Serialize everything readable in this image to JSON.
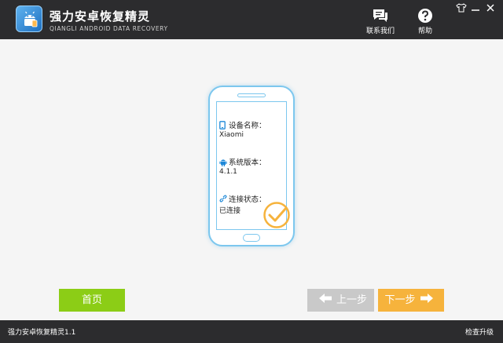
{
  "app": {
    "title": "强力安卓恢复精灵",
    "subtitle": "QIANGLI ANDROID DATA RECOVERY"
  },
  "header": {
    "contact_label": "联系我们",
    "help_label": "帮助"
  },
  "device": {
    "name_label": "设备名称：",
    "name_value": "Xiaomi",
    "version_label": "系统版本：",
    "version_value": "4.1.1",
    "status_label": "连接状态：",
    "status_value": "已连接"
  },
  "nav": {
    "home_label": "首页",
    "prev_label": "上一步",
    "next_label": "下一步"
  },
  "footer": {
    "version": "强力安卓恢复精灵1.1",
    "update_label": "检查升级"
  },
  "colors": {
    "titlebar": "#2c2c2e",
    "home_button": "#8ccd16",
    "prev_button": "#c9c9c9",
    "next_button": "#f6b33c",
    "phone_outline": "#7cc7ee",
    "check_mark": "#f6b33c"
  }
}
